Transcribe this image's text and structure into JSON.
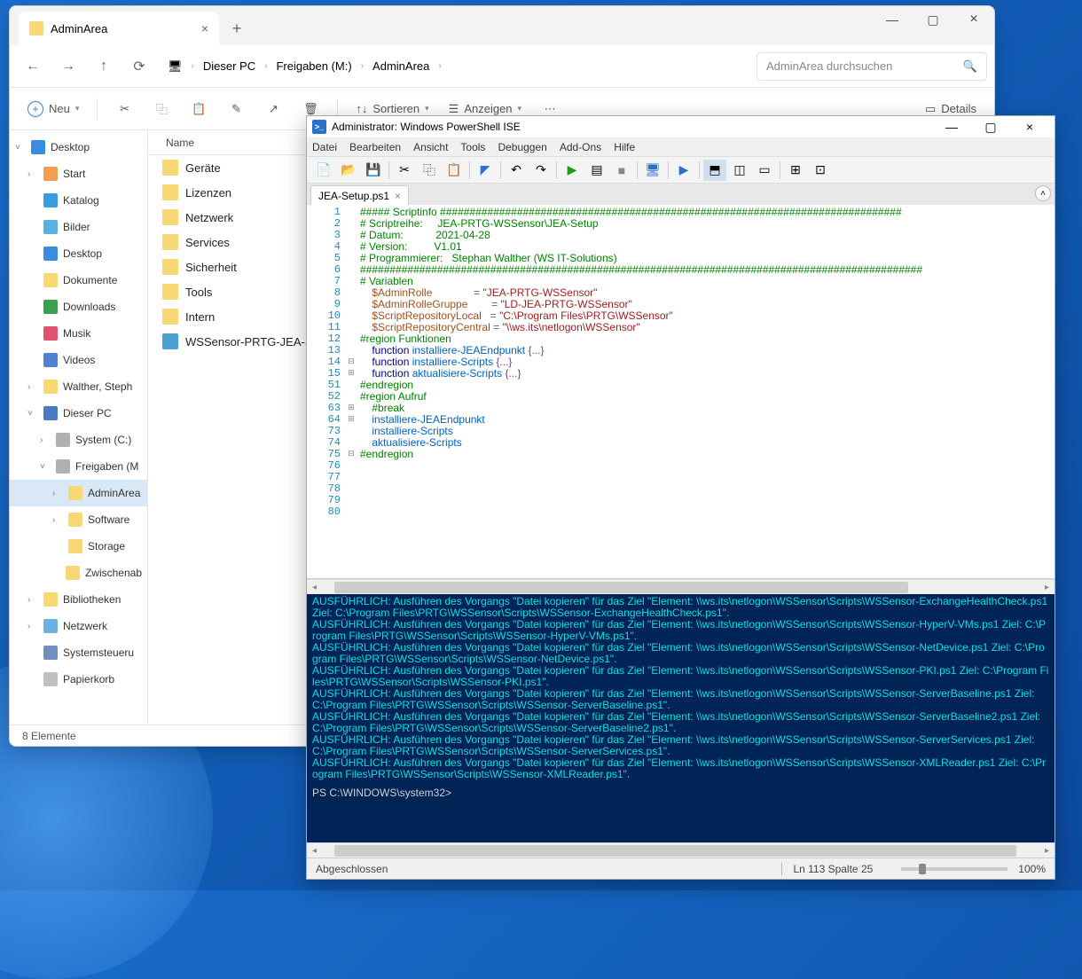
{
  "explorer": {
    "tab_title": "AdminArea",
    "breadcrumb": [
      "Dieser PC",
      "Freigaben (M:)",
      "AdminArea"
    ],
    "search_placeholder": "AdminArea durchsuchen",
    "toolbar": {
      "new_label": "Neu",
      "sort_label": "Sortieren",
      "view_label": "Anzeigen",
      "details_label": "Details"
    },
    "tree": [
      {
        "label": "Desktop",
        "depth": 0,
        "icon": "ic-desktop-blue",
        "chev": "˅"
      },
      {
        "label": "Start",
        "depth": 1,
        "icon": "ic-house",
        "chev": "›"
      },
      {
        "label": "Katalog",
        "depth": 1,
        "icon": "ic-kat",
        "chev": ""
      },
      {
        "label": "Bilder",
        "depth": 1,
        "icon": "ic-pic",
        "chev": ""
      },
      {
        "label": "Desktop",
        "depth": 1,
        "icon": "ic-desktop-blue",
        "chev": ""
      },
      {
        "label": "Dokumente",
        "depth": 1,
        "icon": "ic-folder",
        "chev": ""
      },
      {
        "label": "Downloads",
        "depth": 1,
        "icon": "ic-down",
        "chev": ""
      },
      {
        "label": "Musik",
        "depth": 1,
        "icon": "ic-music",
        "chev": ""
      },
      {
        "label": "Videos",
        "depth": 1,
        "icon": "ic-video",
        "chev": ""
      },
      {
        "label": "Walther, Steph",
        "depth": 1,
        "icon": "ic-folder",
        "chev": "›"
      },
      {
        "label": "Dieser PC",
        "depth": 1,
        "icon": "ic-pc",
        "chev": "˅"
      },
      {
        "label": "System (C:)",
        "depth": 2,
        "icon": "ic-drive",
        "chev": "›"
      },
      {
        "label": "Freigaben (M",
        "depth": 2,
        "icon": "ic-drive",
        "chev": "˅"
      },
      {
        "label": "AdminArea",
        "depth": 3,
        "icon": "ic-folder",
        "chev": "›",
        "selected": true
      },
      {
        "label": "Software",
        "depth": 3,
        "icon": "ic-folder",
        "chev": "›"
      },
      {
        "label": "Storage",
        "depth": 3,
        "icon": "ic-folder",
        "chev": ""
      },
      {
        "label": "Zwischenab",
        "depth": 3,
        "icon": "ic-folder",
        "chev": ""
      },
      {
        "label": "Bibliotheken",
        "depth": 1,
        "icon": "ic-folder",
        "chev": "›"
      },
      {
        "label": "Netzwerk",
        "depth": 1,
        "icon": "ic-net",
        "chev": "›"
      },
      {
        "label": "Systemsteueru",
        "depth": 1,
        "icon": "ic-gear",
        "chev": ""
      },
      {
        "label": "Papierkorb",
        "depth": 1,
        "icon": "ic-bin",
        "chev": ""
      }
    ],
    "list_header": "Name",
    "list_items": [
      {
        "name": "Geräte",
        "icon": "ic-folder"
      },
      {
        "name": "Lizenzen",
        "icon": "ic-folder"
      },
      {
        "name": "Netzwerk",
        "icon": "ic-folder"
      },
      {
        "name": "Services",
        "icon": "ic-folder"
      },
      {
        "name": "Sicherheit",
        "icon": "ic-folder"
      },
      {
        "name": "Tools",
        "icon": "ic-folder"
      },
      {
        "name": "Intern",
        "icon": "ic-folder"
      },
      {
        "name": "WSSensor-PRTG-JEA-Setup",
        "icon": "ic-ps"
      }
    ],
    "status": "8 Elemente"
  },
  "ise": {
    "title": "Administrator: Windows PowerShell ISE",
    "menu": [
      "Datei",
      "Bearbeiten",
      "Ansicht",
      "Tools",
      "Debuggen",
      "Add-Ons",
      "Hilfe"
    ],
    "tab": "JEA-Setup.ps1",
    "line_numbers": [
      "1",
      "2",
      "3",
      "4",
      "5",
      "6",
      "7",
      "8",
      "9",
      "10",
      "11",
      "12",
      "13",
      "14",
      "15",
      "51",
      "52",
      "63",
      "64",
      "73",
      "74",
      "75",
      "76",
      "77",
      "78",
      "79",
      "80"
    ],
    "fold_marks": {
      "13": "⊟",
      "14": "⊞",
      "17": "⊞",
      "18": "⊞",
      "21": "⊟"
    },
    "code_lines": [
      [
        [
          "c-cmt",
          "##### Scriptinfo ##############################################################################"
        ]
      ],
      [
        [
          "c-cmt",
          "# Scriptreihe:     JEA-PRTG-WSSensor\\JEA-Setup"
        ]
      ],
      [
        [
          "c-cmt",
          "# Datum:           2021-04-28"
        ]
      ],
      [
        [
          "c-cmt",
          "# Version:         V1.01"
        ]
      ],
      [
        [
          "c-cmt",
          "# Programmierer:   Stephan Walther (WS IT-Solutions)"
        ]
      ],
      [
        [
          "c-cmt",
          "###############################################################################################"
        ]
      ],
      [
        [
          "",
          ""
        ]
      ],
      [
        [
          "c-cmt",
          "# Variablen"
        ]
      ],
      [
        [
          "",
          "    "
        ],
        [
          "c-vr",
          "$AdminRolle"
        ],
        [
          "",
          "              "
        ],
        [
          "c-op",
          "="
        ],
        [
          "",
          " "
        ],
        [
          "c-st",
          "\"JEA-PRTG-WSSensor\""
        ]
      ],
      [
        [
          "",
          "    "
        ],
        [
          "c-vr",
          "$AdminRolleGruppe"
        ],
        [
          "",
          "        "
        ],
        [
          "c-op",
          "="
        ],
        [
          "",
          " "
        ],
        [
          "c-st",
          "\"LD-JEA-PRTG-WSSensor\""
        ]
      ],
      [
        [
          "",
          "    "
        ],
        [
          "c-vr",
          "$ScriptRepositoryLocal"
        ],
        [
          "",
          "   "
        ],
        [
          "c-op",
          "="
        ],
        [
          "",
          " "
        ],
        [
          "c-st",
          "\"C:\\Program Files\\PRTG\\WSSensor\""
        ]
      ],
      [
        [
          "",
          "    "
        ],
        [
          "c-vr",
          "$ScriptRepositoryCentral"
        ],
        [
          "",
          " "
        ],
        [
          "c-op",
          "="
        ],
        [
          "",
          " "
        ],
        [
          "c-st",
          "\"\\\\ws.its\\netlogon\\WSSensor\""
        ]
      ],
      [
        [
          "",
          ""
        ]
      ],
      [
        [
          "c-cmt",
          "#region Funktionen"
        ]
      ],
      [
        [
          "",
          "    "
        ],
        [
          "c-kw",
          "function"
        ],
        [
          "",
          " "
        ],
        [
          "c-fn",
          "installiere-JEAEndpunkt"
        ],
        [
          "",
          " "
        ],
        [
          "c-plain",
          "{...}"
        ]
      ],
      [
        [
          "",
          ""
        ]
      ],
      [
        [
          "",
          "    "
        ],
        [
          "c-kw",
          "function"
        ],
        [
          "",
          " "
        ],
        [
          "c-fn",
          "installiere-Scripts"
        ],
        [
          "",
          " "
        ],
        [
          "c-plain",
          "{...}"
        ]
      ],
      [
        [
          "",
          ""
        ]
      ],
      [
        [
          "",
          "    "
        ],
        [
          "c-kw",
          "function"
        ],
        [
          "",
          " "
        ],
        [
          "c-fn",
          "aktualisiere-Scripts"
        ],
        [
          "",
          " "
        ],
        [
          "c-plain",
          "{...}"
        ]
      ],
      [
        [
          "c-cmt",
          "#endregion"
        ]
      ],
      [
        [
          "",
          ""
        ]
      ],
      [
        [
          "c-cmt",
          "#region Aufruf"
        ]
      ],
      [
        [
          "",
          "    "
        ],
        [
          "c-cmt",
          "#break"
        ]
      ],
      [
        [
          "",
          "    "
        ],
        [
          "c-fn",
          "installiere-JEAEndpunkt"
        ]
      ],
      [
        [
          "",
          "    "
        ],
        [
          "c-fn",
          "installiere-Scripts"
        ]
      ],
      [
        [
          "",
          "    "
        ],
        [
          "c-fn",
          "aktualisiere-Scripts"
        ]
      ],
      [
        [
          "c-cmt",
          "#endregion"
        ]
      ]
    ],
    "console_lines": [
      "AUSFÜHRLICH: Ausführen des Vorgangs \"Datei kopieren\" für das Ziel \"Element: \\\\ws.its\\netlogon\\WSSensor\\Scripts\\WSSensor-ExchangeHealthCheck.ps1 Ziel: C:\\Program Files\\PRTG\\WSSensor\\Scripts\\WSSensor-ExchangeHealthCheck.ps1\".",
      "AUSFÜHRLICH: Ausführen des Vorgangs \"Datei kopieren\" für das Ziel \"Element: \\\\ws.its\\netlogon\\WSSensor\\Scripts\\WSSensor-HyperV-VMs.ps1 Ziel: C:\\Program Files\\PRTG\\WSSensor\\Scripts\\WSSensor-HyperV-VMs.ps1\".",
      "AUSFÜHRLICH: Ausführen des Vorgangs \"Datei kopieren\" für das Ziel \"Element: \\\\ws.its\\netlogon\\WSSensor\\Scripts\\WSSensor-NetDevice.ps1 Ziel: C:\\Program Files\\PRTG\\WSSensor\\Scripts\\WSSensor-NetDevice.ps1\".",
      "AUSFÜHRLICH: Ausführen des Vorgangs \"Datei kopieren\" für das Ziel \"Element: \\\\ws.its\\netlogon\\WSSensor\\Scripts\\WSSensor-PKI.ps1 Ziel: C:\\Program Files\\PRTG\\WSSensor\\Scripts\\WSSensor-PKI.ps1\".",
      "AUSFÜHRLICH: Ausführen des Vorgangs \"Datei kopieren\" für das Ziel \"Element: \\\\ws.its\\netlogon\\WSSensor\\Scripts\\WSSensor-ServerBaseline.ps1 Ziel: C:\\Program Files\\PRTG\\WSSensor\\Scripts\\WSSensor-ServerBaseline.ps1\".",
      "AUSFÜHRLICH: Ausführen des Vorgangs \"Datei kopieren\" für das Ziel \"Element: \\\\ws.its\\netlogon\\WSSensor\\Scripts\\WSSensor-ServerBaseline2.ps1 Ziel: C:\\Program Files\\PRTG\\WSSensor\\Scripts\\WSSensor-ServerBaseline2.ps1\".",
      "AUSFÜHRLICH: Ausführen des Vorgangs \"Datei kopieren\" für das Ziel \"Element: \\\\ws.its\\netlogon\\WSSensor\\Scripts\\WSSensor-ServerServices.ps1 Ziel: C:\\Program Files\\PRTG\\WSSensor\\Scripts\\WSSensor-ServerServices.ps1\".",
      "AUSFÜHRLICH: Ausführen des Vorgangs \"Datei kopieren\" für das Ziel \"Element: \\\\ws.its\\netlogon\\WSSensor\\Scripts\\WSSensor-XMLReader.ps1 Ziel: C:\\Program Files\\PRTG\\WSSensor\\Scripts\\WSSensor-XMLReader.ps1\"."
    ],
    "prompt": "PS C:\\WINDOWS\\system32>",
    "status_left": "Abgeschlossen",
    "status_pos": "Ln 113  Spalte 25",
    "status_zoom": "100%"
  }
}
